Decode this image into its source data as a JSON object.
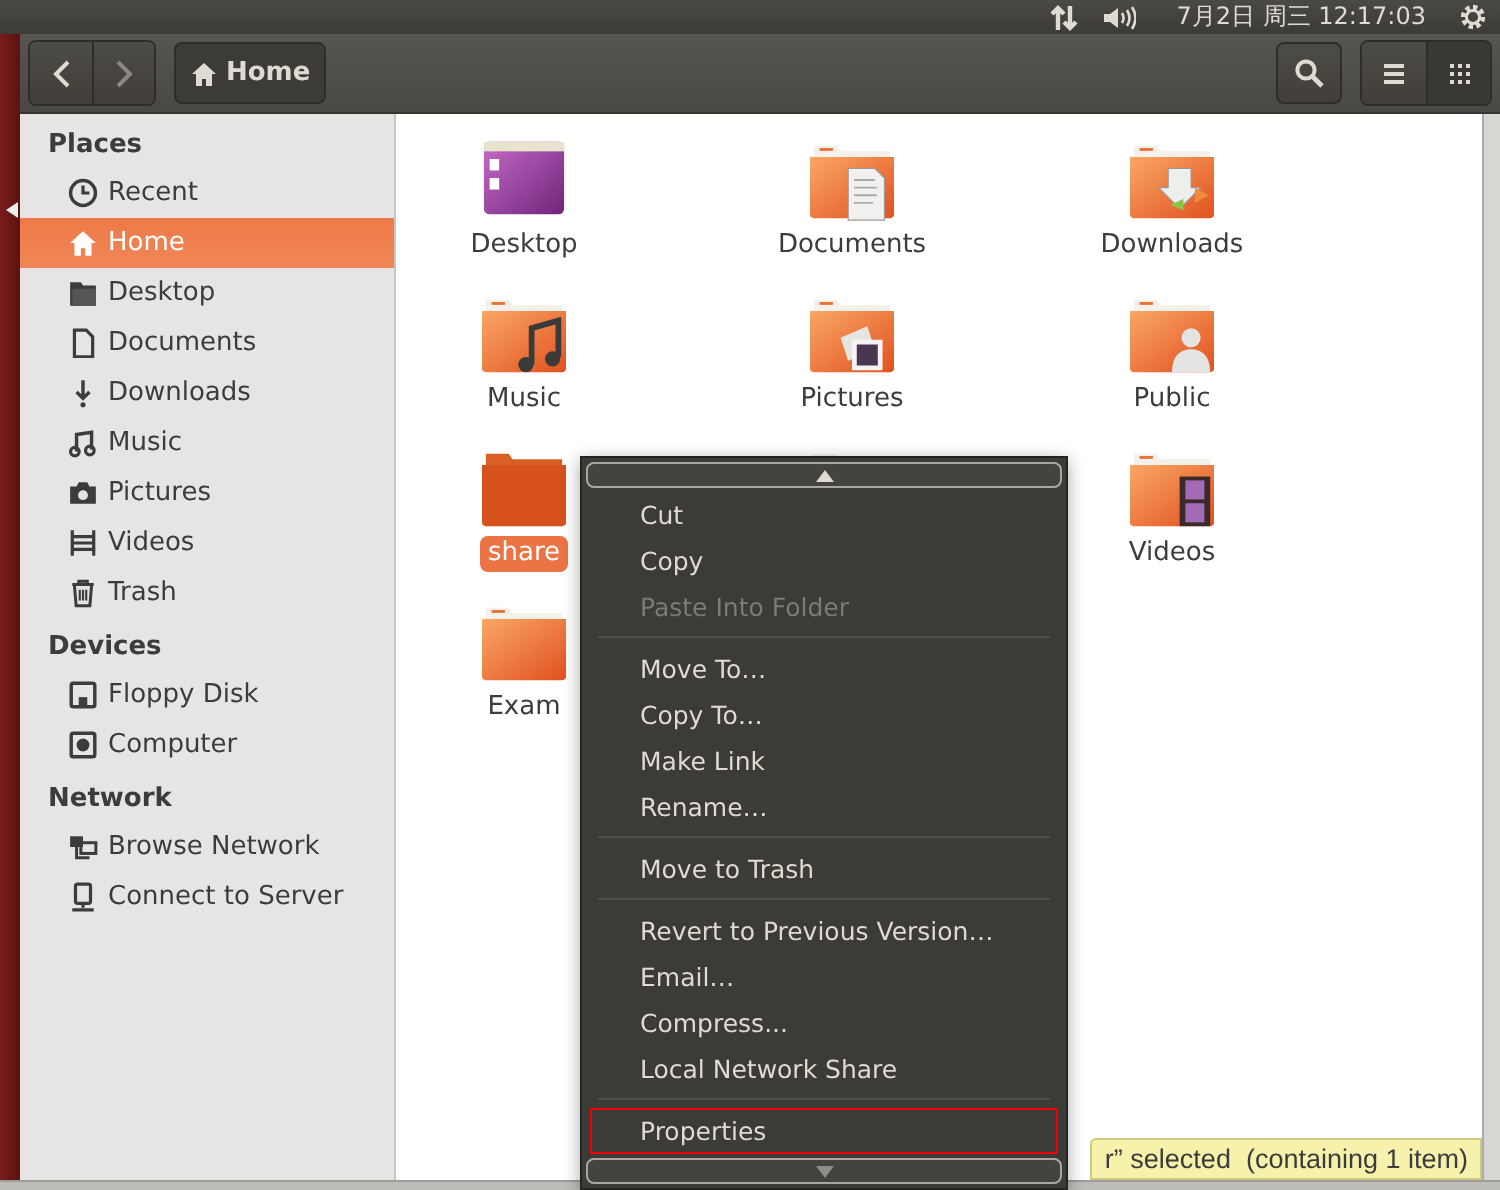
{
  "top_panel": {
    "clock": "7月2日 周三 12:17:03"
  },
  "header": {
    "path_button": "Home",
    "view_buttons": [
      {
        "kind": "list",
        "selected": false
      },
      {
        "kind": "grid",
        "selected": true
      }
    ]
  },
  "sidebar": {
    "sections": [
      {
        "title": "Places",
        "items": [
          {
            "label": "Recent",
            "kind": "recent",
            "selected": false
          },
          {
            "label": "Home",
            "kind": "home",
            "selected": true
          },
          {
            "label": "Desktop",
            "kind": "desktop",
            "selected": false
          },
          {
            "label": "Documents",
            "kind": "documents",
            "selected": false
          },
          {
            "label": "Downloads",
            "kind": "downloads",
            "selected": false
          },
          {
            "label": "Music",
            "kind": "music",
            "selected": false
          },
          {
            "label": "Pictures",
            "kind": "pictures",
            "selected": false
          },
          {
            "label": "Videos",
            "kind": "videos",
            "selected": false
          },
          {
            "label": "Trash",
            "kind": "trash",
            "selected": false
          }
        ]
      },
      {
        "title": "Devices",
        "items": [
          {
            "label": "Floppy Disk",
            "kind": "floppy",
            "selected": false
          },
          {
            "label": "Computer",
            "kind": "computer",
            "selected": false
          }
        ]
      },
      {
        "title": "Network",
        "items": [
          {
            "label": "Browse Network",
            "kind": "network",
            "selected": false
          },
          {
            "label": "Connect to Server",
            "kind": "server",
            "selected": false
          }
        ]
      }
    ]
  },
  "files": [
    {
      "label": "Desktop",
      "kind": "desktop",
      "selected": false
    },
    {
      "label": "Documents",
      "kind": "documents",
      "selected": false
    },
    {
      "label": "Downloads",
      "kind": "downloads",
      "selected": false
    },
    {
      "label": "Music",
      "kind": "music",
      "selected": false
    },
    {
      "label": "Pictures",
      "kind": "pictures",
      "selected": false
    },
    {
      "label": "Public",
      "kind": "public",
      "selected": false
    },
    {
      "label": "share",
      "kind": "shared",
      "selected": true
    },
    {
      "kind": "folder"
    },
    {
      "label": "Videos",
      "kind": "videos",
      "selected": false
    },
    {
      "label": "Exam",
      "kind": "folder",
      "selected": false
    }
  ],
  "context_menu": {
    "groups": [
      {
        "items": [
          {
            "label": "Cut",
            "disabled": false,
            "annotated": false
          },
          {
            "label": "Copy",
            "disabled": false,
            "annotated": false
          },
          {
            "label": "Paste Into Folder",
            "disabled": true,
            "annotated": false
          }
        ]
      },
      {
        "items": [
          {
            "label": "Move To…",
            "disabled": false,
            "annotated": false
          },
          {
            "label": "Copy To…",
            "disabled": false,
            "annotated": false
          },
          {
            "label": "Make Link",
            "disabled": false,
            "annotated": false
          },
          {
            "label": "Rename…",
            "disabled": false,
            "annotated": false
          }
        ]
      },
      {
        "items": [
          {
            "label": "Move to Trash",
            "disabled": false,
            "annotated": false
          }
        ]
      },
      {
        "items": [
          {
            "label": "Revert to Previous Version…",
            "disabled": false,
            "annotated": false
          },
          {
            "label": "Email…",
            "disabled": false,
            "annotated": false
          },
          {
            "label": "Compress...",
            "disabled": false,
            "annotated": false
          },
          {
            "label": "Local Network Share",
            "disabled": false,
            "annotated": false
          }
        ]
      },
      {
        "items": [
          {
            "label": "Properties",
            "disabled": false,
            "annotated": true
          }
        ]
      }
    ]
  },
  "status_bar": "r” selected  (containing 1 item)"
}
